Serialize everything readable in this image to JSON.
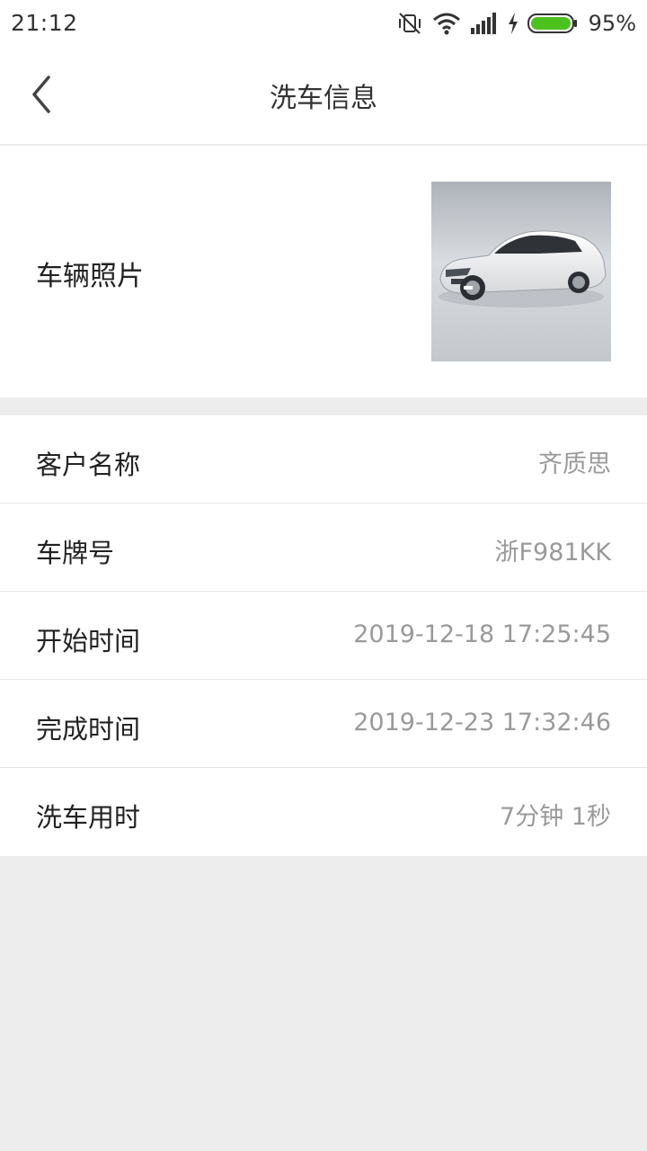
{
  "status_bar": {
    "time": "21:12",
    "battery_percent": "95%",
    "icons": [
      "vibrate-off-icon",
      "wifi-icon",
      "signal-icon",
      "charging-bolt-icon",
      "battery-icon"
    ],
    "battery_color": "#4cc21e"
  },
  "nav": {
    "title": "洗车信息",
    "back_icon": "chevron-left-icon"
  },
  "photo": {
    "label": "车辆照片"
  },
  "info": {
    "rows": [
      {
        "label": "客户名称",
        "value": "齐质思"
      },
      {
        "label": "车牌号",
        "value": "浙F981KK"
      },
      {
        "label": "开始时间",
        "value": "2019-12-18 17:25:45"
      },
      {
        "label": "完成时间",
        "value": "2019-12-23 17:32:46"
      },
      {
        "label": "洗车用时",
        "value": "7分钟 1秒"
      }
    ]
  }
}
